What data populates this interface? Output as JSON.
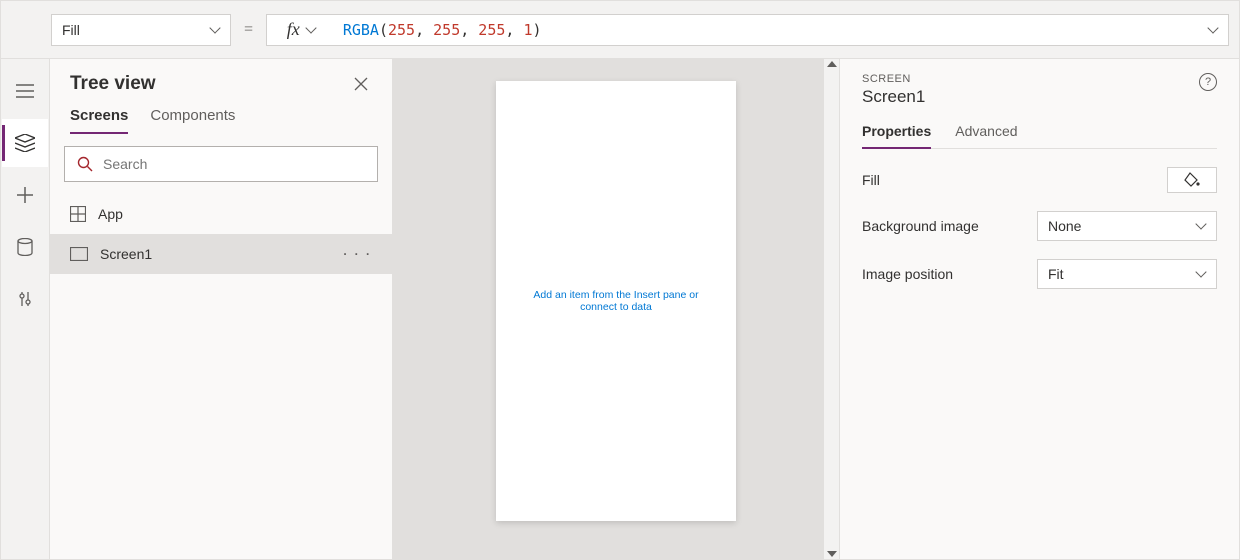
{
  "formula_bar": {
    "property": "Fill",
    "expression": {
      "fn": "RGBA",
      "args": [
        "255",
        "255",
        "255",
        "1"
      ]
    }
  },
  "tree_view": {
    "title": "Tree view",
    "tabs": [
      "Screens",
      "Components"
    ],
    "active_tab": 0,
    "search_placeholder": "Search",
    "items": [
      {
        "label": "App",
        "icon": "app"
      },
      {
        "label": "Screen1",
        "icon": "screen",
        "selected": true
      }
    ]
  },
  "canvas": {
    "hint": "Add an item from the Insert pane or connect to data"
  },
  "properties": {
    "type": "SCREEN",
    "name": "Screen1",
    "tabs": [
      "Properties",
      "Advanced"
    ],
    "active_tab": 0,
    "rows": {
      "fill_label": "Fill",
      "bg_label": "Background image",
      "bg_value": "None",
      "imgpos_label": "Image position",
      "imgpos_value": "Fit"
    }
  }
}
